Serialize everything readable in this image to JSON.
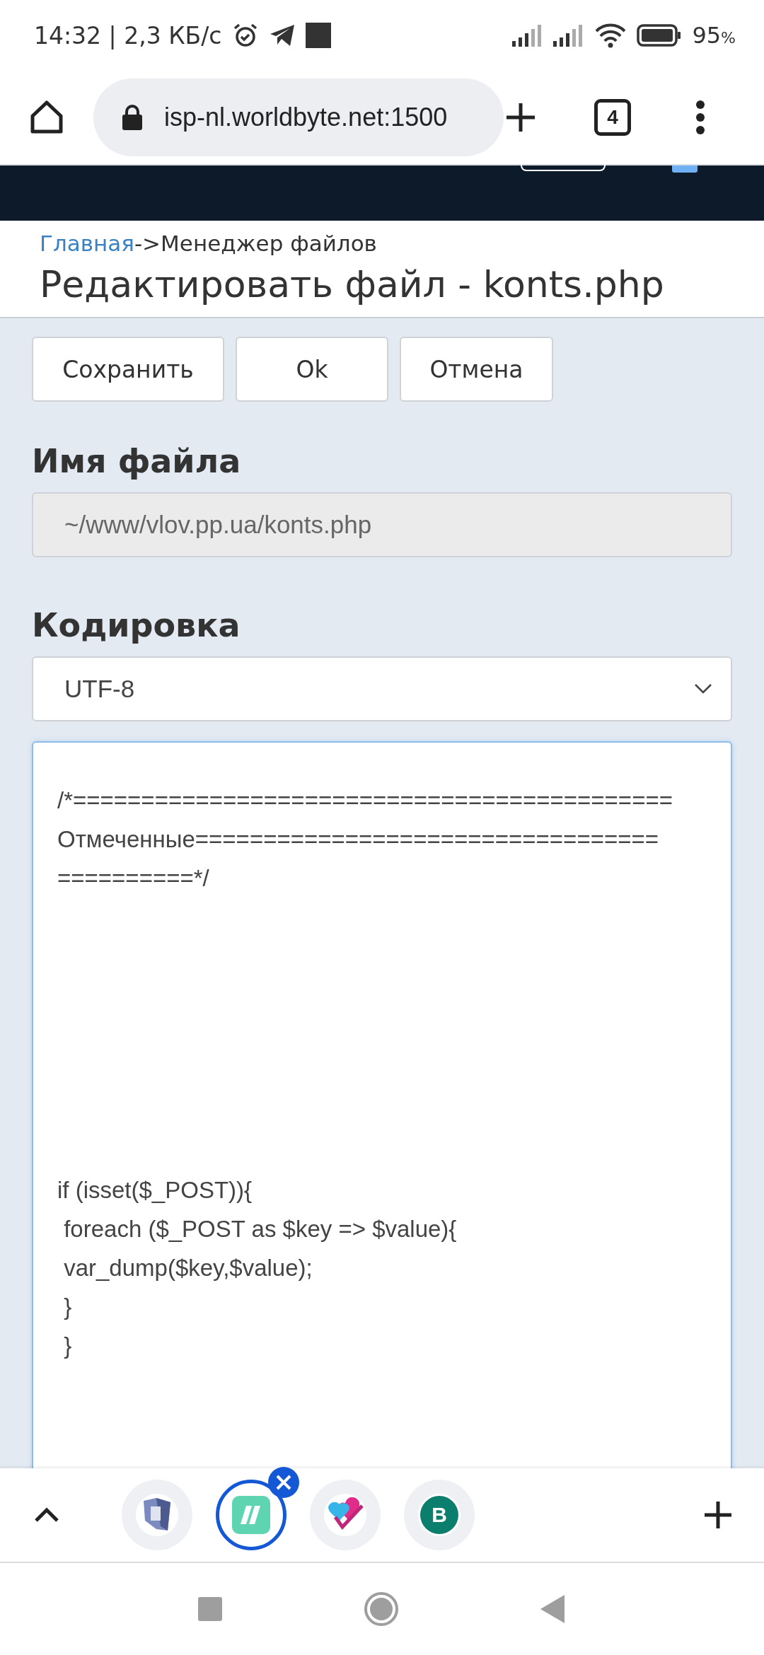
{
  "status_bar": {
    "time": "14:32 | 2,3 КБ/с",
    "battery_percent": "95",
    "percent_sign": "%"
  },
  "browser": {
    "url": "isp-nl.worldbyte.net:1500",
    "tab_count": "4"
  },
  "breadcrumb": {
    "link": "Главная",
    "current": "->Менеджер файлов"
  },
  "title": "Редактировать файл - konts.php",
  "buttons": [
    "Сохранить",
    "Ok",
    "Отмена"
  ],
  "filename": {
    "label": "Имя файла",
    "value": "~/www/vlov.pp.ua/konts.php",
    "disabled": true
  },
  "encoding": {
    "label": "Кодировка",
    "value": "UTF-8"
  },
  "editor": {
    "comment_lines": [
      "/*============================================",
      "Отмеченные==================================",
      "==========*/"
    ],
    "code_lines": [
      "if (isset($_POST)){",
      " foreach ($_POST as $key => $value){",
      " var_dump($key,$value);",
      " }",
      " }"
    ]
  },
  "tab_strip": [
    {
      "kind": "shield",
      "selected": false
    },
    {
      "kind": "slashes",
      "selected": true
    },
    {
      "kind": "hearts",
      "selected": false
    },
    {
      "kind": "letter",
      "letter": "B",
      "selected": false
    }
  ]
}
